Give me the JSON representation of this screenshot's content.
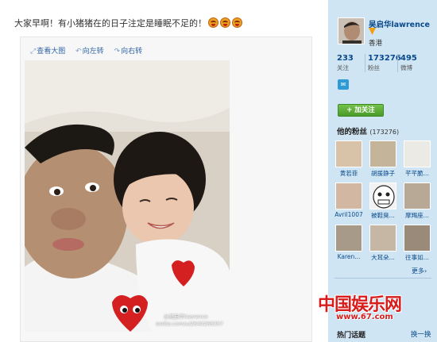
{
  "post": {
    "text": "大家早啊！有小猪猪在的日子注定是睡眠不足的！"
  },
  "media_tools": {
    "view_large": "查看大图",
    "rotate_left": "向左转",
    "rotate_right": "向右转"
  },
  "photo_watermark": {
    "line1": "@吴启华lawrence",
    "line2": "weibo.com/u/2640266357"
  },
  "profile": {
    "name": "吴启华lawrence",
    "location": "香港",
    "stats": [
      {
        "num": "233",
        "label": "关注"
      },
      {
        "num": "173276",
        "label": "粉丝"
      },
      {
        "num": "495",
        "label": "微博"
      }
    ],
    "follow_label": "+ 加关注"
  },
  "fans": {
    "title": "他的粉丝",
    "count": "(173276)",
    "items": [
      {
        "name": "黄若菲"
      },
      {
        "name": "胡援静子"
      },
      {
        "name": "芊芊脆..."
      },
      {
        "name": "Avril1007"
      },
      {
        "name": "被鞋臭..."
      },
      {
        "name": "摩羯座..."
      },
      {
        "name": "Karen..."
      },
      {
        "name": "大耳朵..."
      },
      {
        "name": "往事如..."
      }
    ],
    "more": "更多›"
  },
  "sections": {
    "hot_topics": "热门话题",
    "change": "换一换"
  },
  "site": {
    "logo": "中国娱乐网",
    "url": "www.67.com"
  }
}
